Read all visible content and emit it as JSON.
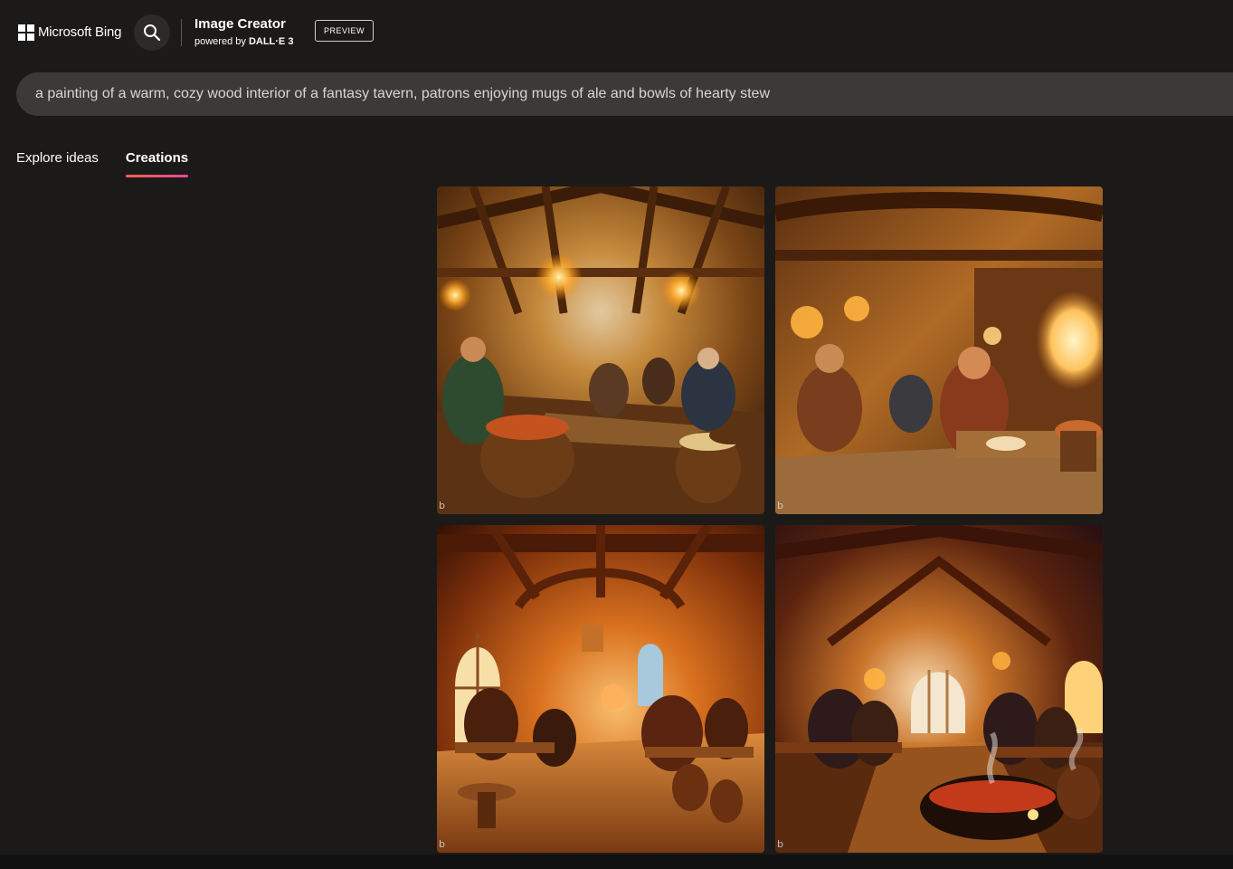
{
  "header": {
    "brand_name": "Microsoft Bing",
    "product_title": "Image Creator",
    "powered_by_prefix": "powered by",
    "powered_by_model": "DALL·E 3",
    "preview_badge": "PREVIEW"
  },
  "prompt": {
    "value": "a painting of a warm, cozy wood interior of a fantasy tavern, patrons enjoying mugs of ale and bowls of hearty stew"
  },
  "tabs": [
    {
      "label": "Explore ideas",
      "active": false
    },
    {
      "label": "Creations",
      "active": true
    }
  ],
  "results": {
    "images": [
      {
        "name": "tavern-image-1"
      },
      {
        "name": "tavern-image-2"
      },
      {
        "name": "tavern-image-3"
      },
      {
        "name": "tavern-image-4"
      }
    ],
    "watermark": "b"
  },
  "icons": {
    "brand": "windows-logo-icon",
    "search": "search-icon"
  },
  "colors": {
    "background": "#1b1a19",
    "prompt_bar": "#3b3a39",
    "tab_underline_start": "#f0634c",
    "tab_underline_end": "#e8459a"
  }
}
